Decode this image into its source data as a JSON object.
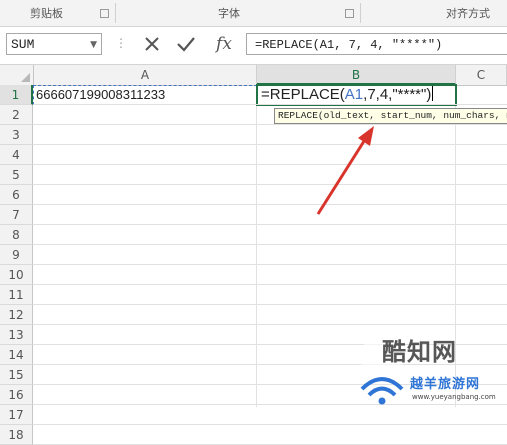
{
  "ribbon": {
    "groups": [
      "剪贴板",
      "字体",
      "对齐方式"
    ]
  },
  "formula_bar": {
    "name_box": "SUM",
    "formula_text": "=REPLACE(A1, 7, 4, \"****\")",
    "cancel_icon": "x-icon",
    "enter_icon": "check-icon",
    "insert_function_label": "fx"
  },
  "grid": {
    "columns": [
      "A",
      "B",
      "C"
    ],
    "rows": [
      "1",
      "2",
      "3",
      "4",
      "5",
      "6",
      "7",
      "8",
      "9",
      "10",
      "11",
      "12",
      "13",
      "14",
      "15",
      "16",
      "17",
      "18"
    ],
    "cells": {
      "A1": "666607199008311233",
      "B1": {
        "prefix": "=REPLACE(",
        "ref": "A1",
        "suffix": ",7,4,\"****\")"
      }
    },
    "active_column": "B",
    "active_row": "1"
  },
  "tooltip": "REPLACE(old_text, start_num, num_chars, new_text)",
  "watermark": {
    "main": "酷知网",
    "sub": "越羊旅游网",
    "url": "www.yueyangbang.com"
  },
  "colors": {
    "accent": "#217346",
    "reference": "#4472c4",
    "arrow": "#d9342b"
  }
}
